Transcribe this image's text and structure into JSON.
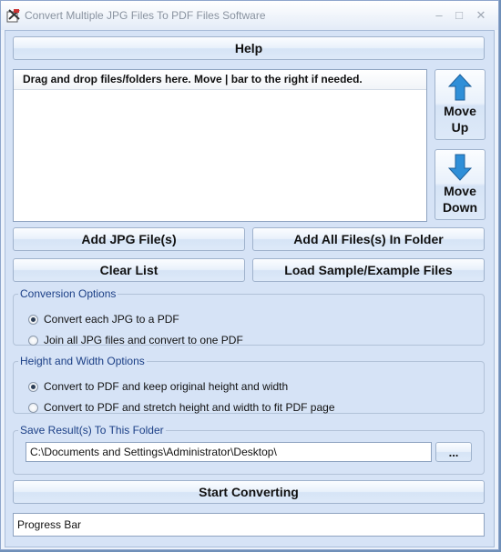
{
  "window": {
    "title": "Convert Multiple JPG Files To PDF Files Software",
    "controls": {
      "minimize": "–",
      "maximize": "□",
      "close": "✕"
    }
  },
  "help_button": "Help",
  "file_list": {
    "header": "Drag and drop files/folders here. Move | bar to the right if needed."
  },
  "move_up": {
    "line1": "Move",
    "line2": "Up"
  },
  "move_down": {
    "line1": "Move",
    "line2": "Down"
  },
  "buttons": {
    "add_files": "Add JPG File(s)",
    "add_folder": "Add All Files(s) In Folder",
    "clear_list": "Clear List",
    "load_sample": "Load Sample/Example Files",
    "browse": "...",
    "start": "Start Converting"
  },
  "conversion_options": {
    "title": "Conversion Options",
    "options": [
      {
        "label": "Convert each JPG to a PDF",
        "selected": true
      },
      {
        "label": "Join all JPG files and convert to one PDF",
        "selected": false
      }
    ]
  },
  "size_options": {
    "title": "Height and Width Options",
    "options": [
      {
        "label": "Convert to PDF and keep original height and width",
        "selected": true
      },
      {
        "label": "Convert to PDF and stretch height and width to fit PDF page",
        "selected": false
      }
    ]
  },
  "save_folder": {
    "title": "Save Result(s) To This Folder",
    "path": "C:\\Documents and Settings\\Administrator\\Desktop\\"
  },
  "progress_bar": {
    "label": "Progress Bar"
  },
  "colors": {
    "accent_arrow": "#2f8fd8",
    "panel": "#d6e3f6"
  }
}
